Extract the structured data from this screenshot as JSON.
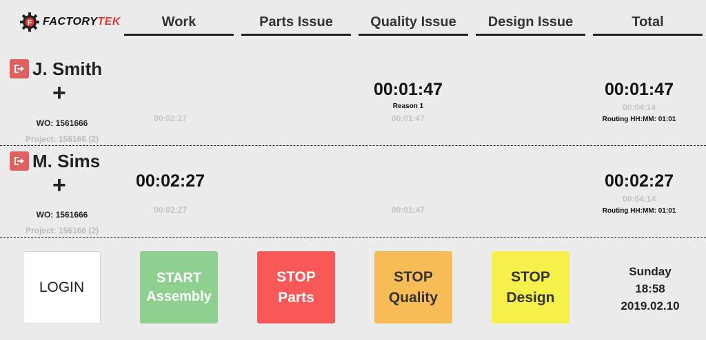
{
  "brand": {
    "prefix": "FACTORY",
    "suffix": "TEK",
    "accent": "#e53935"
  },
  "columns": [
    "Work",
    "Parts Issue",
    "Quality Issue",
    "Design Issue",
    "Total"
  ],
  "employees": [
    {
      "name": "J. Smith",
      "add_symbol": "+",
      "wo": "WO: 1561666",
      "project": "Project: 156166 (2)",
      "work_active": "",
      "work_total": "00:02:27",
      "quality_active": "00:01:47",
      "quality_reason": "Reason 1",
      "quality_total": "00:01:47",
      "total_active": "00:01:47",
      "total_sum": "00:04:14",
      "routing": "Routing HH:MM: 01:01"
    },
    {
      "name": "M. Sims",
      "add_symbol": "+",
      "wo": "WO: 1561666",
      "project": "Project: 156166 (2)",
      "work_active": "00:02:27",
      "work_total": "00:02:27",
      "quality_active": "",
      "quality_reason": "",
      "quality_total": "00:01:47",
      "total_active": "00:02:27",
      "total_sum": "00:04:14",
      "routing": "Routing HH:MM: 01:01"
    }
  ],
  "buttons": {
    "login": "LOGIN",
    "start_line1": "START",
    "start_line2": "Assembly",
    "stop_parts_line1": "STOP",
    "stop_parts_line2": "Parts",
    "stop_quality_line1": "STOP",
    "stop_quality_line2": "Quality",
    "stop_design_line1": "STOP",
    "stop_design_line2": "Design"
  },
  "datetime": {
    "day": "Sunday",
    "time": "18:58",
    "date": "2019.02.10"
  }
}
